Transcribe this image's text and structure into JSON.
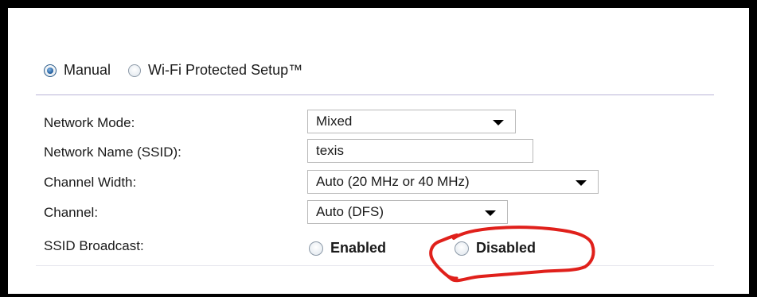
{
  "setup_mode": {
    "manual_label": "Manual",
    "manual_checked": true,
    "wps_label": "Wi-Fi Protected Setup™",
    "wps_checked": false
  },
  "fields": {
    "network_mode": {
      "label": "Network Mode:",
      "value": "Mixed"
    },
    "network_name": {
      "label": "Network Name (SSID):",
      "value": "texis"
    },
    "channel_width": {
      "label": "Channel Width:",
      "value": "Auto (20 MHz or 40 MHz)"
    },
    "channel": {
      "label": "Channel:",
      "value": "Auto (DFS)"
    },
    "ssid_broadcast": {
      "label": "SSID Broadcast:",
      "enabled_label": "Enabled",
      "disabled_label": "Disabled",
      "selected": "none"
    }
  },
  "colors": {
    "frame": "#000000",
    "divider": "#b8b3d6",
    "annotation": "#e0201b",
    "radio_selected": "#1e5a99"
  }
}
